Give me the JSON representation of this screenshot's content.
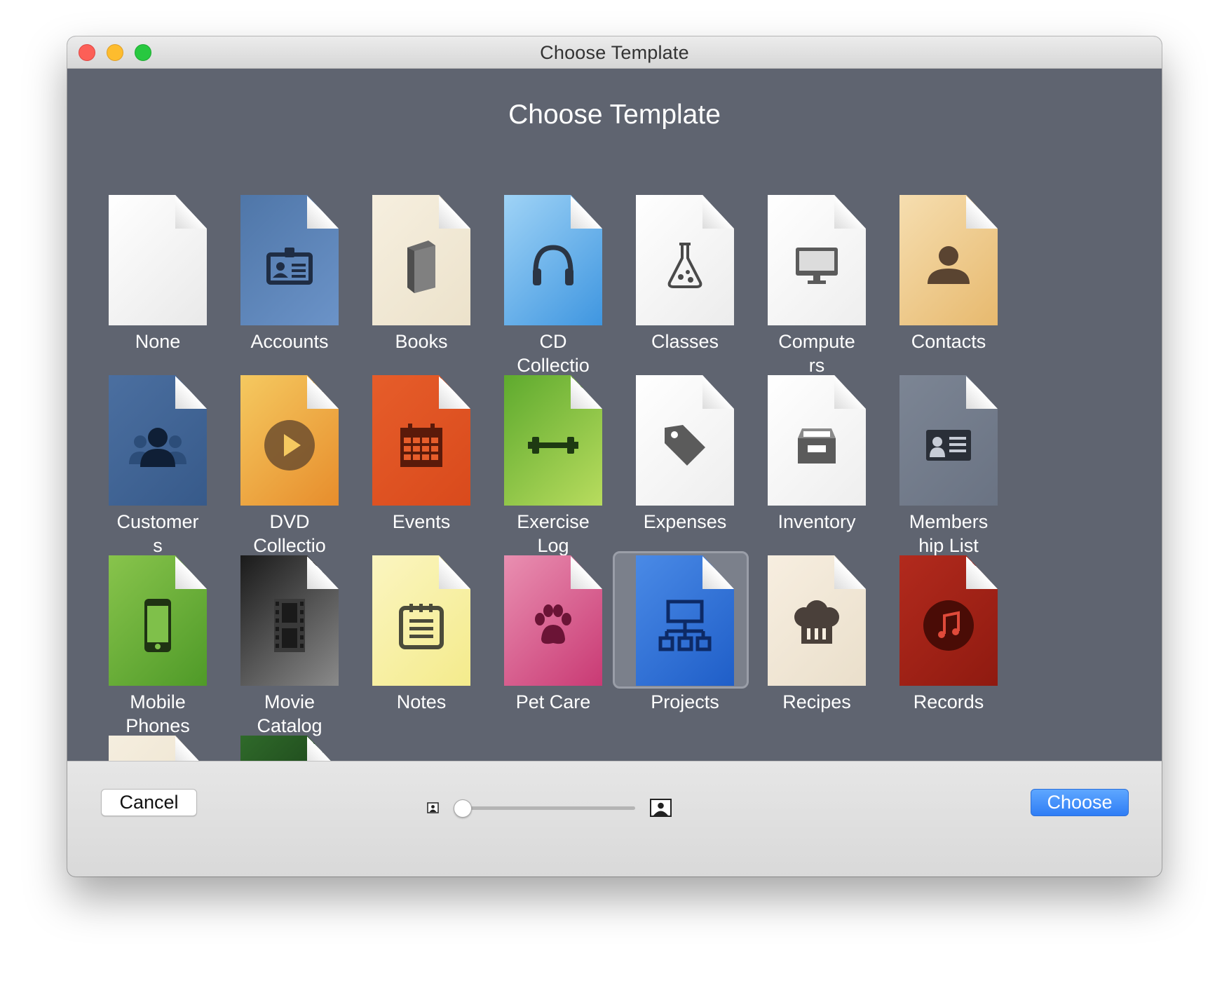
{
  "window": {
    "title": "Choose Template"
  },
  "heading": "Choose Template",
  "templates": [
    {
      "name": "None",
      "icon": "blank-document-icon",
      "colors": [
        "#ffffff",
        "#e9e9e9"
      ],
      "selected": false
    },
    {
      "name": "Accounts",
      "icon": "id-card-icon",
      "colors": [
        "#4f76a8",
        "#6b93c8"
      ],
      "selected": false
    },
    {
      "name": "Books",
      "icon": "book-icon",
      "colors": [
        "#f6efdf",
        "#ece2cb"
      ],
      "selected": false
    },
    {
      "name": "CD\nCollectio",
      "icon": "headphones-icon",
      "colors": [
        "#9fd3f6",
        "#3f96e0"
      ],
      "selected": false
    },
    {
      "name": "Classes",
      "icon": "flask-icon",
      "colors": [
        "#ffffff",
        "#ececec"
      ],
      "selected": false
    },
    {
      "name": "Compute\nrs",
      "icon": "computer-monitor-icon",
      "colors": [
        "#ffffff",
        "#eeeeee"
      ],
      "selected": false
    },
    {
      "name": "Contacts",
      "icon": "person-silhouette-icon",
      "colors": [
        "#f6deb0",
        "#e7b96e"
      ],
      "selected": false
    },
    {
      "name": "Customer\ns",
      "icon": "people-group-icon",
      "colors": [
        "#4b6fa0",
        "#375a8a"
      ],
      "selected": false
    },
    {
      "name": "DVD\nCollectio",
      "icon": "play-disc-icon",
      "colors": [
        "#f5c960",
        "#e78d2c"
      ],
      "selected": false
    },
    {
      "name": "Events",
      "icon": "calendar-icon",
      "colors": [
        "#e65d2a",
        "#d94a1c"
      ],
      "selected": false
    },
    {
      "name": "Exercise\nLog",
      "icon": "dumbbell-icon",
      "colors": [
        "#5eaa2e",
        "#b8dc5e"
      ],
      "selected": false
    },
    {
      "name": "Expenses",
      "icon": "price-tag-icon",
      "colors": [
        "#ffffff",
        "#eeeeee"
      ],
      "selected": false
    },
    {
      "name": "Inventory",
      "icon": "inbox-tray-icon",
      "colors": [
        "#ffffff",
        "#eeeeee"
      ],
      "selected": false
    },
    {
      "name": "Members\nhip List",
      "icon": "member-card-icon",
      "colors": [
        "#7c8594",
        "#6a7383"
      ],
      "selected": false
    },
    {
      "name": "Mobile\nPhones",
      "icon": "mobile-phone-icon",
      "colors": [
        "#88c44c",
        "#4f9a28"
      ],
      "selected": false
    },
    {
      "name": "Movie\nCatalog",
      "icon": "film-strip-icon",
      "colors": [
        "#1a1a1a",
        "#8a8a8a"
      ],
      "selected": false
    },
    {
      "name": "Notes",
      "icon": "notepad-icon",
      "colors": [
        "#fbf5c0",
        "#f4eb8c"
      ],
      "selected": false
    },
    {
      "name": "Pet Care",
      "icon": "paw-print-icon",
      "colors": [
        "#e98fb1",
        "#c93a74"
      ],
      "selected": false
    },
    {
      "name": "Projects",
      "icon": "project-diagram-icon",
      "colors": [
        "#4a8ae6",
        "#1f5ec8"
      ],
      "selected": true
    },
    {
      "name": "Recipes",
      "icon": "chef-hat-icon",
      "colors": [
        "#f7eee0",
        "#eadfcb"
      ],
      "selected": false
    },
    {
      "name": "Records",
      "icon": "music-record-icon",
      "colors": [
        "#b22a1d",
        "#8f1a10"
      ],
      "selected": false
    },
    {
      "name": "",
      "icon": "partial-cream-document-icon",
      "colors": [
        "#f5eedf",
        "#ebe0c9"
      ],
      "selected": false
    },
    {
      "name": "",
      "icon": "partial-nature-document-icon",
      "colors": [
        "#2f6a2a",
        "#0f2a0f"
      ],
      "selected": false
    }
  ],
  "footer": {
    "cancel_label": "Cancel",
    "choose_label": "Choose",
    "icon_size_slider": {
      "value": 0,
      "min_icon": "small-photo-icon",
      "max_icon": "large-photo-icon"
    }
  },
  "colors": {
    "accent": "#2f7df5",
    "background": "#5f6470"
  }
}
